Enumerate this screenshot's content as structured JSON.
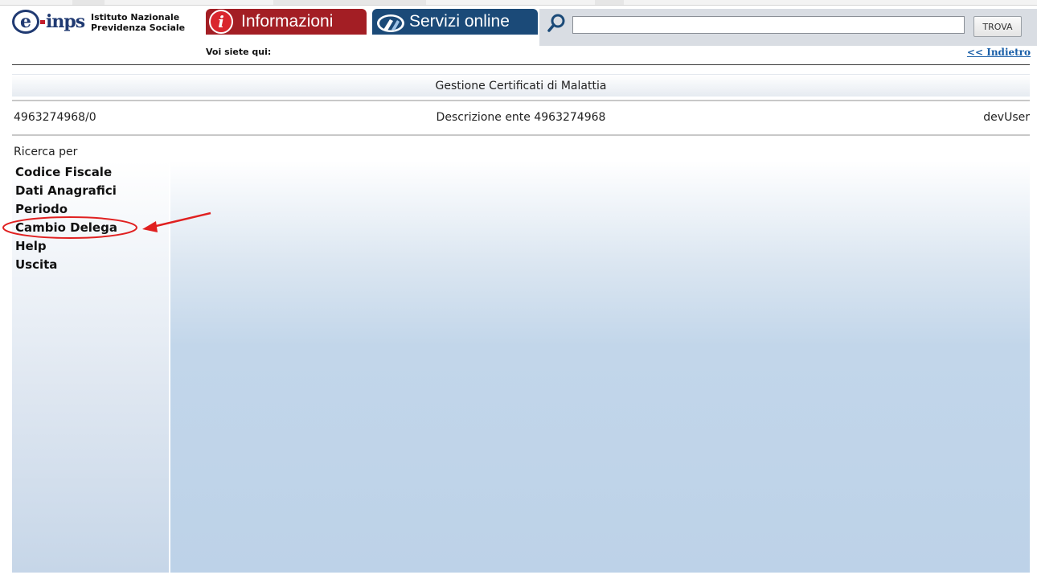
{
  "header": {
    "logo_text": "e-inps",
    "institute_line1": "Istituto Nazionale",
    "institute_line2": "Previdenza Sociale",
    "tab_info_label": "Informazioni",
    "tab_services_label": "Servizi online",
    "search_value": "",
    "search_button_label": "TROVA",
    "breadcrumb_label": "Voi siete qui:",
    "back_link_label": "<< Indietro"
  },
  "page": {
    "title": "Gestione Certificati di Malattia",
    "entity_code": "4963274968/0",
    "entity_description": "Descrizione ente 4963274968",
    "username": "devUser",
    "search_by_label": "Ricerca per"
  },
  "sidebar": {
    "items": [
      {
        "label": "Codice Fiscale"
      },
      {
        "label": "Dati Anagrafici"
      },
      {
        "label": "Periodo"
      },
      {
        "label": "Cambio Delega"
      },
      {
        "label": "Help"
      },
      {
        "label": "Uscita"
      }
    ]
  },
  "annotation": {
    "highlighted_item": "Cambio Delega",
    "color": "#e02020"
  },
  "colors": {
    "info_tab": "#a31e24",
    "services_tab": "#1b4a78",
    "brand_blue": "#203a72",
    "link": "#1a5fa8",
    "panel": "#bdd2e8"
  },
  "icons": {
    "info": "info-icon",
    "services": "online-services-icon",
    "search": "search-icon"
  }
}
